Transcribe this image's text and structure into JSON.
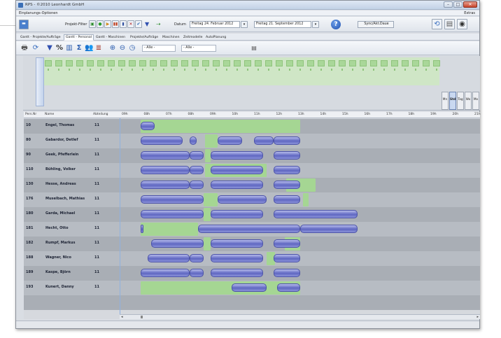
{
  "window": {
    "title": "RPS - ©2010 Leonhardt GmbH",
    "btn_min": "–",
    "btn_max": "□",
    "btn_close": "✕"
  },
  "menu": {
    "left": "Einplanungs-Optionen",
    "right": "Extras"
  },
  "toolbar": {
    "project_filter_label": "Projekt-Filter",
    "buttons": [
      "▣",
      "●",
      "▶",
      "▮▮",
      "▮",
      "✕",
      "✔"
    ],
    "funnel_glyph": "▼",
    "link_glyph": "⇢",
    "date_label": "Datum",
    "from_day": "Freitag",
    "from_date": "24. Februar 2012",
    "to_day": "Freitag",
    "to_date": "21. September 2012",
    "sync_label": "Sync/Akt.Daue",
    "help_label": "?"
  },
  "tabs": [
    "Gantt - Projekte/Aufträge",
    "Gantt - Personal",
    "Gantt - Maschinen",
    "Projekte/Aufträge",
    "Maschinen",
    "Zeitmodelle",
    "AutoPlanung"
  ],
  "active_tab": 1,
  "toolbar2": {
    "filter1": "- Alle -",
    "filter2": "- Alle -",
    "icons": {
      "printer": "🖶",
      "refresh": "⟳",
      "funnel": "▼",
      "percent": "%",
      "columns": "▥",
      "sigma": "Σ",
      "people": "👥",
      "bars": "≣",
      "zoom_in": "⊕",
      "zoom_out": "⊖",
      "clock": "◷",
      "layout": "▤"
    }
  },
  "views": [
    "Mn",
    "Std",
    "Tag",
    "Wo",
    "Mo"
  ],
  "active_view": 1,
  "grid": {
    "headers": [
      "Pers.Nr",
      "Name",
      "Abteilung"
    ],
    "times": [
      "09h",
      "08h",
      "07h",
      "08h",
      "09h",
      "10h",
      "11h",
      "12h",
      "13h",
      "14h",
      "15h",
      "16h",
      "17h",
      "18h",
      "19h",
      "20h",
      "21h"
    ],
    "rows": [
      {
        "nr": "10",
        "name": "Engel, Thomas",
        "abt": "11"
      },
      {
        "nr": "80",
        "name": "Gabardor, Detlef",
        "abt": "11"
      },
      {
        "nr": "90",
        "name": "Geek, Pfefferlein",
        "abt": "11"
      },
      {
        "nr": "110",
        "name": "Bühling, Volker",
        "abt": "11"
      },
      {
        "nr": "130",
        "name": "Hesse, Andreas",
        "abt": "11"
      },
      {
        "nr": "176",
        "name": "Muselbach, Mathias",
        "abt": "11"
      },
      {
        "nr": "180",
        "name": "Garda, Michael",
        "abt": "11"
      },
      {
        "nr": "181",
        "name": "Hecht, Otto",
        "abt": "11"
      },
      {
        "nr": "182",
        "name": "Rumpf, Markus",
        "abt": "11"
      },
      {
        "nr": "188",
        "name": "Wagner, Nico",
        "abt": "11"
      },
      {
        "nr": "189",
        "name": "Kaspe, Björn",
        "abt": "11"
      },
      {
        "nr": "193",
        "name": "Kunert, Danny",
        "abt": "11"
      }
    ]
  },
  "scroll": {
    "left": "◂",
    "right": "▸"
  }
}
